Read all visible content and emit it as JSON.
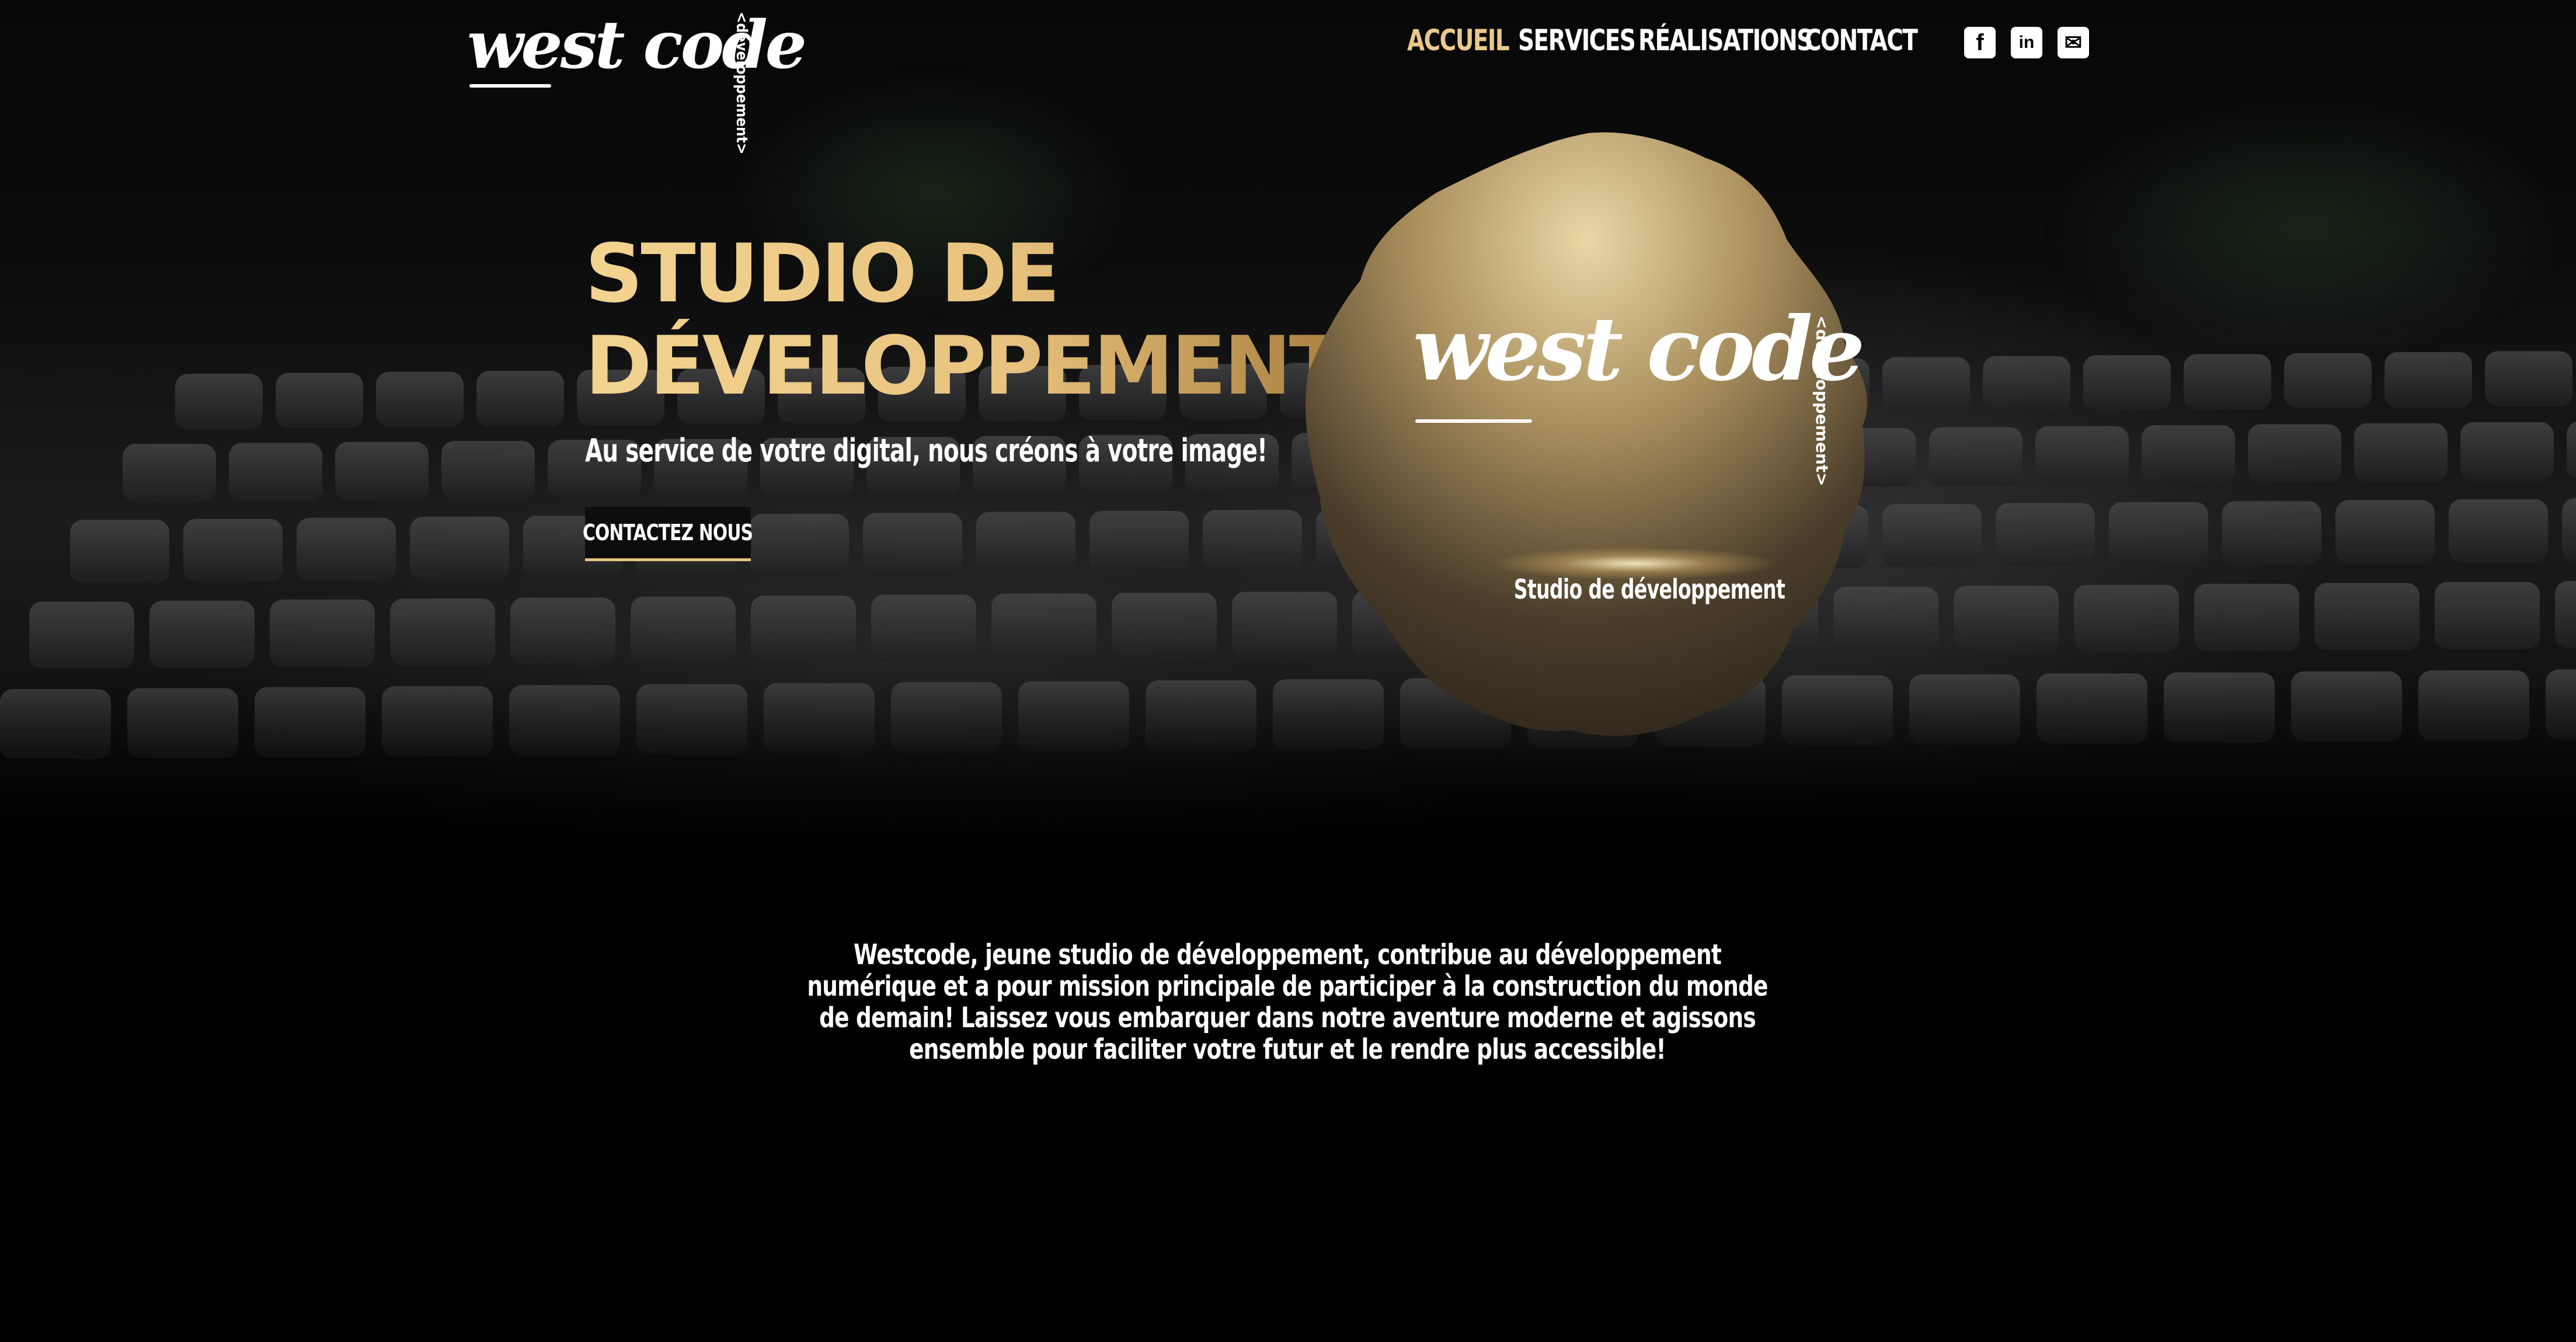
{
  "header": {
    "logo": {
      "text": "west code",
      "tag": "<développement>"
    },
    "nav": [
      {
        "label": "ACCUEIL",
        "active": true
      },
      {
        "label": "SERVICES",
        "active": false
      },
      {
        "label": "RÉALISATIONS",
        "active": false
      },
      {
        "label": "CONTACT",
        "active": false
      }
    ],
    "social": [
      {
        "icon": "facebook-icon",
        "glyph": "f"
      },
      {
        "icon": "linkedin-icon",
        "glyph": "in"
      },
      {
        "icon": "email-icon",
        "glyph": "✉"
      }
    ]
  },
  "hero": {
    "title_line1": "STUDIO DE",
    "title_line2": "DÉVELOPPEMENT",
    "subtitle": "Au service de votre digital, nous créons à votre image!",
    "cta_label": "CONTACTEZ NOUS"
  },
  "badge": {
    "logo_text": "west code",
    "logo_tag": "<développement>",
    "caption": "Studio de développement"
  },
  "intro": {
    "text": "Westcode, jeune studio de développement, contribue au développement numérique et a pour mission principale de participer à la construction du monde de demain! Laissez vous embarquer dans notre aventure moderne et agissons ensemble pour faciliter votre futur et le rendre plus accessible!"
  },
  "colors": {
    "accent_gold": "#e9c98b",
    "background": "#000000",
    "text": "#ffffff"
  }
}
